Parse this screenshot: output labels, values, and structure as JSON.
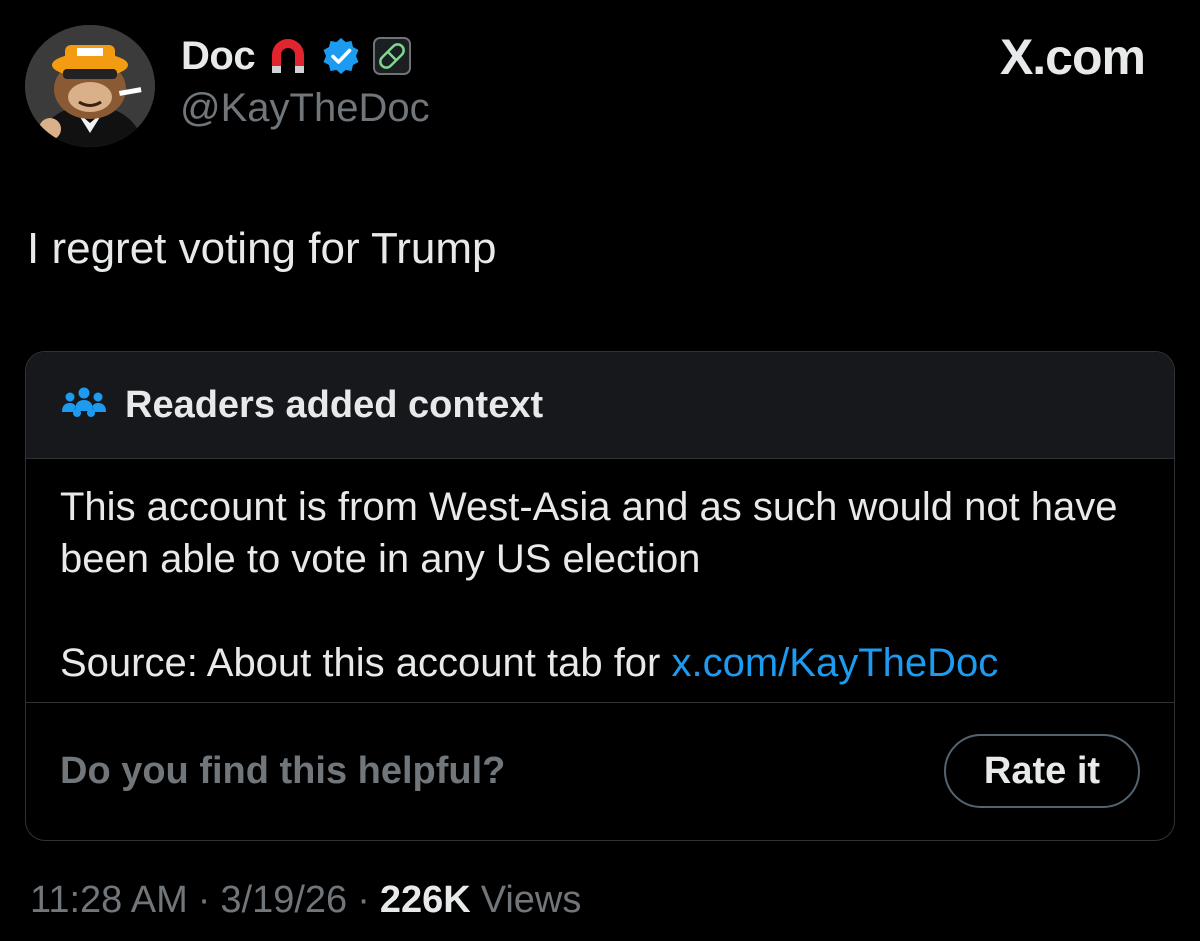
{
  "author": {
    "display_name": "Doc",
    "handle": "@KayTheDoc",
    "badges": [
      "magnet-icon",
      "verified-badge-icon",
      "pill-icon"
    ]
  },
  "site_mark": "X.com",
  "tweet": {
    "text": "I regret voting for Trump"
  },
  "community_note": {
    "header_icon": "people-icon",
    "title": "Readers added context",
    "body": "This account is from West-Asia and as such would not have been able to vote in any US election",
    "source_prefix": "Source: About this account tab for ",
    "source_link": "x.com/KayTheDoc",
    "helpful_question": "Do you find this helpful?",
    "rate_button": "Rate it"
  },
  "meta": {
    "time": "11:28 AM",
    "separator": "·",
    "date": "3/19/26",
    "views_count": "226K",
    "views_label": "Views"
  },
  "colors": {
    "background": "#000000",
    "text_primary": "#e7e9ea",
    "text_secondary": "#71767b",
    "link": "#1d9bf0",
    "verified": "#1d9bf0",
    "card_border": "#2f3336",
    "card_header_bg": "#16181c"
  }
}
